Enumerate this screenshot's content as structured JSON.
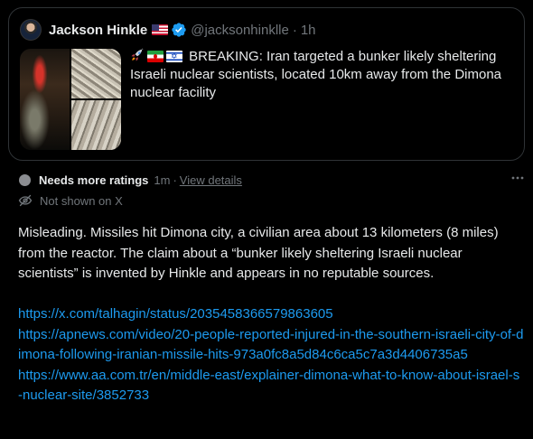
{
  "quoted_post": {
    "author_name": "Jackson Hinkle",
    "handle": "@jacksonhinklle",
    "separator": "·",
    "time": "1h",
    "text": "BREAKING: Iran targeted a bunker likely sheltering Israeli nuclear scientists, located 10km away from the Dimona nuclear facility",
    "icons": [
      "us-flag",
      "verified-badge",
      "rocket",
      "iran-flag",
      "israel-flag"
    ],
    "accent_color": "#1d9bf0"
  },
  "note": {
    "status": "Needs more ratings",
    "age": "1m",
    "separator": "·",
    "details_link": "View details",
    "visibility": "Not shown on X",
    "body": "Misleading. Missiles hit Dimona city, a civilian area about 13 kilometers (8 miles) from the reactor. The claim about a “bunker likely sheltering Israeli nuclear scientists” is invented by Hinkle and appears in no reputable sources.",
    "links": [
      "https://x.com/talhagin/status/2035458366579863605",
      "https://apnews.com/video/20-people-reported-injured-in-the-southern-israeli-city-of-dimona-following-iranian-missile-hits-973a0fc8a5d84c6ca5c7a3d4406735a5",
      "https://www.aa.com.tr/en/middle-east/explainer-dimona-what-to-know-about-israel-s-nuclear-site/3852733"
    ],
    "link_color": "#1d9bf0",
    "status_color": "#8b8d91"
  }
}
